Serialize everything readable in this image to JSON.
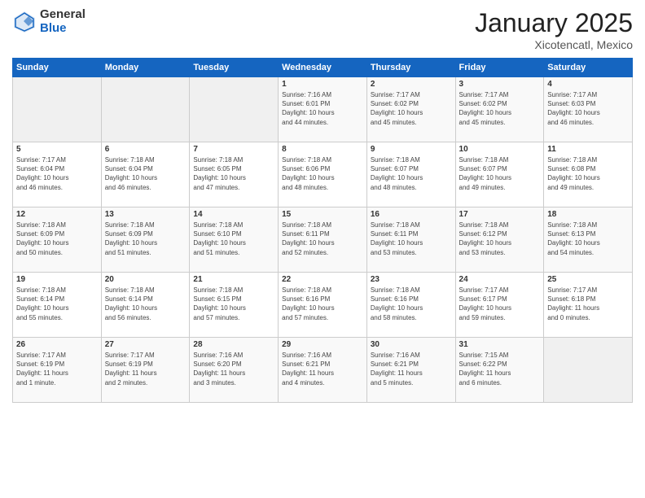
{
  "logo": {
    "general": "General",
    "blue": "Blue"
  },
  "title": "January 2025",
  "subtitle": "Xicotencatl, Mexico",
  "days_of_week": [
    "Sunday",
    "Monday",
    "Tuesday",
    "Wednesday",
    "Thursday",
    "Friday",
    "Saturday"
  ],
  "weeks": [
    [
      {
        "day": "",
        "content": ""
      },
      {
        "day": "",
        "content": ""
      },
      {
        "day": "",
        "content": ""
      },
      {
        "day": "1",
        "content": "Sunrise: 7:16 AM\nSunset: 6:01 PM\nDaylight: 10 hours\nand 44 minutes."
      },
      {
        "day": "2",
        "content": "Sunrise: 7:17 AM\nSunset: 6:02 PM\nDaylight: 10 hours\nand 45 minutes."
      },
      {
        "day": "3",
        "content": "Sunrise: 7:17 AM\nSunset: 6:02 PM\nDaylight: 10 hours\nand 45 minutes."
      },
      {
        "day": "4",
        "content": "Sunrise: 7:17 AM\nSunset: 6:03 PM\nDaylight: 10 hours\nand 46 minutes."
      }
    ],
    [
      {
        "day": "5",
        "content": "Sunrise: 7:17 AM\nSunset: 6:04 PM\nDaylight: 10 hours\nand 46 minutes."
      },
      {
        "day": "6",
        "content": "Sunrise: 7:18 AM\nSunset: 6:04 PM\nDaylight: 10 hours\nand 46 minutes."
      },
      {
        "day": "7",
        "content": "Sunrise: 7:18 AM\nSunset: 6:05 PM\nDaylight: 10 hours\nand 47 minutes."
      },
      {
        "day": "8",
        "content": "Sunrise: 7:18 AM\nSunset: 6:06 PM\nDaylight: 10 hours\nand 48 minutes."
      },
      {
        "day": "9",
        "content": "Sunrise: 7:18 AM\nSunset: 6:07 PM\nDaylight: 10 hours\nand 48 minutes."
      },
      {
        "day": "10",
        "content": "Sunrise: 7:18 AM\nSunset: 6:07 PM\nDaylight: 10 hours\nand 49 minutes."
      },
      {
        "day": "11",
        "content": "Sunrise: 7:18 AM\nSunset: 6:08 PM\nDaylight: 10 hours\nand 49 minutes."
      }
    ],
    [
      {
        "day": "12",
        "content": "Sunrise: 7:18 AM\nSunset: 6:09 PM\nDaylight: 10 hours\nand 50 minutes."
      },
      {
        "day": "13",
        "content": "Sunrise: 7:18 AM\nSunset: 6:09 PM\nDaylight: 10 hours\nand 51 minutes."
      },
      {
        "day": "14",
        "content": "Sunrise: 7:18 AM\nSunset: 6:10 PM\nDaylight: 10 hours\nand 51 minutes."
      },
      {
        "day": "15",
        "content": "Sunrise: 7:18 AM\nSunset: 6:11 PM\nDaylight: 10 hours\nand 52 minutes."
      },
      {
        "day": "16",
        "content": "Sunrise: 7:18 AM\nSunset: 6:11 PM\nDaylight: 10 hours\nand 53 minutes."
      },
      {
        "day": "17",
        "content": "Sunrise: 7:18 AM\nSunset: 6:12 PM\nDaylight: 10 hours\nand 53 minutes."
      },
      {
        "day": "18",
        "content": "Sunrise: 7:18 AM\nSunset: 6:13 PM\nDaylight: 10 hours\nand 54 minutes."
      }
    ],
    [
      {
        "day": "19",
        "content": "Sunrise: 7:18 AM\nSunset: 6:14 PM\nDaylight: 10 hours\nand 55 minutes."
      },
      {
        "day": "20",
        "content": "Sunrise: 7:18 AM\nSunset: 6:14 PM\nDaylight: 10 hours\nand 56 minutes."
      },
      {
        "day": "21",
        "content": "Sunrise: 7:18 AM\nSunset: 6:15 PM\nDaylight: 10 hours\nand 57 minutes."
      },
      {
        "day": "22",
        "content": "Sunrise: 7:18 AM\nSunset: 6:16 PM\nDaylight: 10 hours\nand 57 minutes."
      },
      {
        "day": "23",
        "content": "Sunrise: 7:18 AM\nSunset: 6:16 PM\nDaylight: 10 hours\nand 58 minutes."
      },
      {
        "day": "24",
        "content": "Sunrise: 7:17 AM\nSunset: 6:17 PM\nDaylight: 10 hours\nand 59 minutes."
      },
      {
        "day": "25",
        "content": "Sunrise: 7:17 AM\nSunset: 6:18 PM\nDaylight: 11 hours\nand 0 minutes."
      }
    ],
    [
      {
        "day": "26",
        "content": "Sunrise: 7:17 AM\nSunset: 6:19 PM\nDaylight: 11 hours\nand 1 minute."
      },
      {
        "day": "27",
        "content": "Sunrise: 7:17 AM\nSunset: 6:19 PM\nDaylight: 11 hours\nand 2 minutes."
      },
      {
        "day": "28",
        "content": "Sunrise: 7:16 AM\nSunset: 6:20 PM\nDaylight: 11 hours\nand 3 minutes."
      },
      {
        "day": "29",
        "content": "Sunrise: 7:16 AM\nSunset: 6:21 PM\nDaylight: 11 hours\nand 4 minutes."
      },
      {
        "day": "30",
        "content": "Sunrise: 7:16 AM\nSunset: 6:21 PM\nDaylight: 11 hours\nand 5 minutes."
      },
      {
        "day": "31",
        "content": "Sunrise: 7:15 AM\nSunset: 6:22 PM\nDaylight: 11 hours\nand 6 minutes."
      },
      {
        "day": "",
        "content": ""
      }
    ]
  ]
}
